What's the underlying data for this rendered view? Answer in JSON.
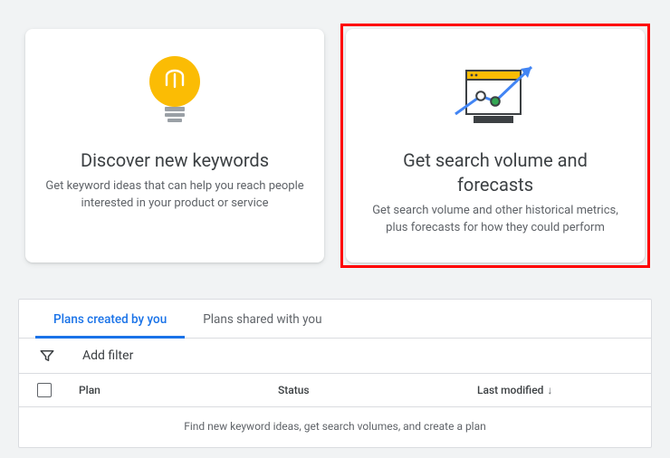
{
  "cards": {
    "discover": {
      "title": "Discover new keywords",
      "desc": "Get keyword ideas that can help you reach people interested in your product or service"
    },
    "forecast": {
      "title": "Get search volume and forecasts",
      "desc": "Get search volume and other historical metrics, plus forecasts for how they could perform"
    }
  },
  "tabs": {
    "created": "Plans created by you",
    "shared": "Plans shared with you"
  },
  "filter": {
    "add_label": "Add filter"
  },
  "table": {
    "cols": {
      "plan": "Plan",
      "status": "Status",
      "last": "Last modified"
    },
    "empty": "Find new keyword ideas, get search volumes, and create a plan"
  }
}
